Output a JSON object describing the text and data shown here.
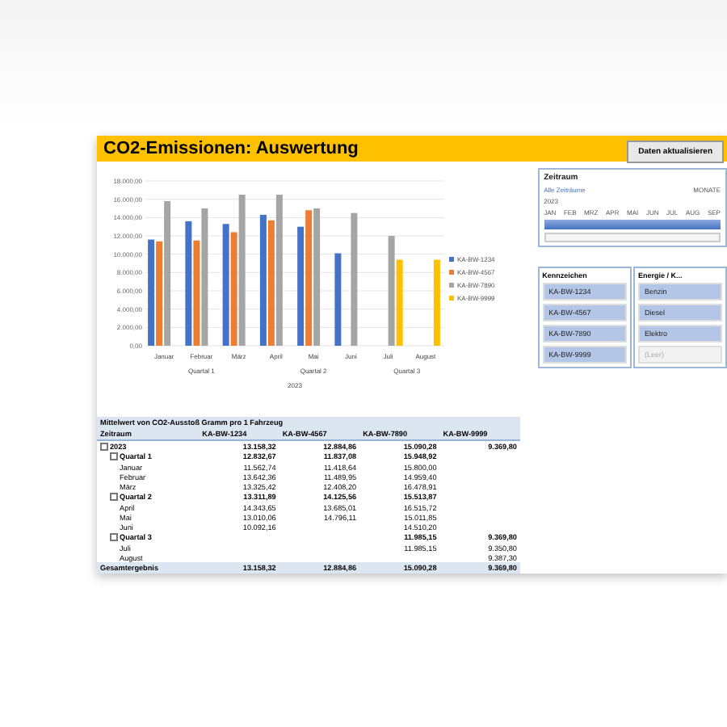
{
  "title": "CO2-Emissionen: Auswertung",
  "refresh_button": "Daten aktualisieren",
  "chart": {
    "chart_data": {
      "type": "bar",
      "categories": [
        "Januar",
        "Februar",
        "März",
        "April",
        "Mai",
        "Juni",
        "Juli",
        "August"
      ],
      "series": [
        {
          "name": "KA-BW-1234",
          "color": "#4472c4",
          "values": [
            11600,
            13600,
            13300,
            14300,
            13000,
            10100,
            null,
            null
          ]
        },
        {
          "name": "KA-BW-4567",
          "color": "#ed7d31",
          "values": [
            11400,
            11500,
            12400,
            13700,
            14800,
            null,
            null,
            null
          ]
        },
        {
          "name": "KA-BW-7890",
          "color": "#a5a5a5",
          "values": [
            15800,
            15000,
            16500,
            16500,
            15000,
            14500,
            12000,
            null
          ]
        },
        {
          "name": "KA-BW-9999",
          "color": "#ffc000",
          "values": [
            null,
            null,
            null,
            null,
            null,
            null,
            9400,
            9400
          ]
        }
      ],
      "ylim": [
        0,
        18000
      ],
      "yticks": [
        {
          "value": 0,
          "label": "0,00"
        },
        {
          "value": 2000,
          "label": "2.000,00"
        },
        {
          "value": 4000,
          "label": "4.000,00"
        },
        {
          "value": 6000,
          "label": "6.000,00"
        },
        {
          "value": 8000,
          "label": "8.000,00"
        },
        {
          "value": 10000,
          "label": "10.000,00"
        },
        {
          "value": 12000,
          "label": "12.000,00"
        },
        {
          "value": 14000,
          "label": "14.000,00"
        },
        {
          "value": 16000,
          "label": "16.000,00"
        },
        {
          "value": 18000,
          "label": "18.000,00"
        }
      ],
      "grid": true,
      "legend": "right"
    },
    "groups": [
      "Quartal 1",
      "Quartal 2",
      "Quartal 3"
    ],
    "year": "2023"
  },
  "timeline": {
    "title": "Zeitraum",
    "all": "Alle Zeiträume",
    "unit": "MONATE",
    "year": "2023",
    "months": [
      "JAN",
      "FEB",
      "MRZ",
      "APR",
      "MAI",
      "JUN",
      "JUL",
      "AUG",
      "SEP"
    ]
  },
  "slicers": [
    {
      "title": "Kennzeichen",
      "items": [
        {
          "label": "KA-BW-1234",
          "selected": true
        },
        {
          "label": "KA-BW-4567",
          "selected": true
        },
        {
          "label": "KA-BW-7890",
          "selected": true
        },
        {
          "label": "KA-BW-9999",
          "selected": true
        }
      ]
    },
    {
      "title": "Energie / K...",
      "items": [
        {
          "label": "Benzin",
          "selected": true
        },
        {
          "label": "Diesel",
          "selected": true
        },
        {
          "label": "Elektro",
          "selected": true
        },
        {
          "label": "(Leer)",
          "selected": false
        }
      ]
    }
  ],
  "pivot": {
    "caption": "Mittelwert von CO2-Ausstoß Gramm pro 1 Fahrzeug",
    "columns": [
      "Zeitraum",
      "KA-BW-1234",
      "KA-BW-4567",
      "KA-BW-7890",
      "KA-BW-9999"
    ],
    "rows": [
      {
        "label": "2023",
        "cells": {
          "col_1": "13.158,32",
          "col_2": "12.884,86",
          "col_3": "15.090,28",
          "col_4": "9.369,80"
        },
        "children": [
          {
            "label": "Quartal 1",
            "cells": {
              "col_1": "12.832,67",
              "col_2": "11.837,08",
              "col_3": "15.948,92"
            },
            "children": [
              {
                "label": "Januar",
                "cells": {
                  "col_1": "11.562,74",
                  "col_2": "11.418,64",
                  "col_3": "15.800,00"
                }
              },
              {
                "label": "Februar",
                "cells": {
                  "col_1": "13.642,36",
                  "col_2": "11.489,95",
                  "col_3": "14.959,40"
                }
              },
              {
                "label": "März",
                "cells": {
                  "col_1": "13.325,42",
                  "col_2": "12.408,20",
                  "col_3": "16.478,91"
                }
              }
            ]
          },
          {
            "label": "Quartal 2",
            "cells": {
              "col_1": "13.311,89",
              "col_2": "14.125,56",
              "col_3": "15.513,87"
            },
            "children": [
              {
                "label": "April",
                "cells": {
                  "col_1": "14.343,65",
                  "col_2": "13.685,01",
                  "col_3": "16.515,72"
                }
              },
              {
                "label": "Mai",
                "cells": {
                  "col_1": "13.010,06",
                  "col_2": "14.796,11",
                  "col_3": "15.011,85"
                }
              },
              {
                "label": "Juni",
                "cells": {
                  "col_1": "10.092,16",
                  "col_3": "14.510,20"
                }
              }
            ]
          },
          {
            "label": "Quartal 3",
            "cells": {
              "col_3": "11.985,15",
              "col_4": "9.369,80"
            },
            "children": [
              {
                "label": "Juli",
                "cells": {
                  "col_3": "11.985,15",
                  "col_4": "9.350,80"
                }
              },
              {
                "label": "August",
                "cells": {
                  "col_4": "9.387,30"
                }
              }
            ]
          }
        ]
      }
    ],
    "total": {
      "label": "Gesamtergebnis",
      "cells": {
        "col_1": "13.158,32",
        "col_2": "12.884,86",
        "col_3": "15.090,28",
        "col_4": "9.369,80"
      }
    }
  }
}
